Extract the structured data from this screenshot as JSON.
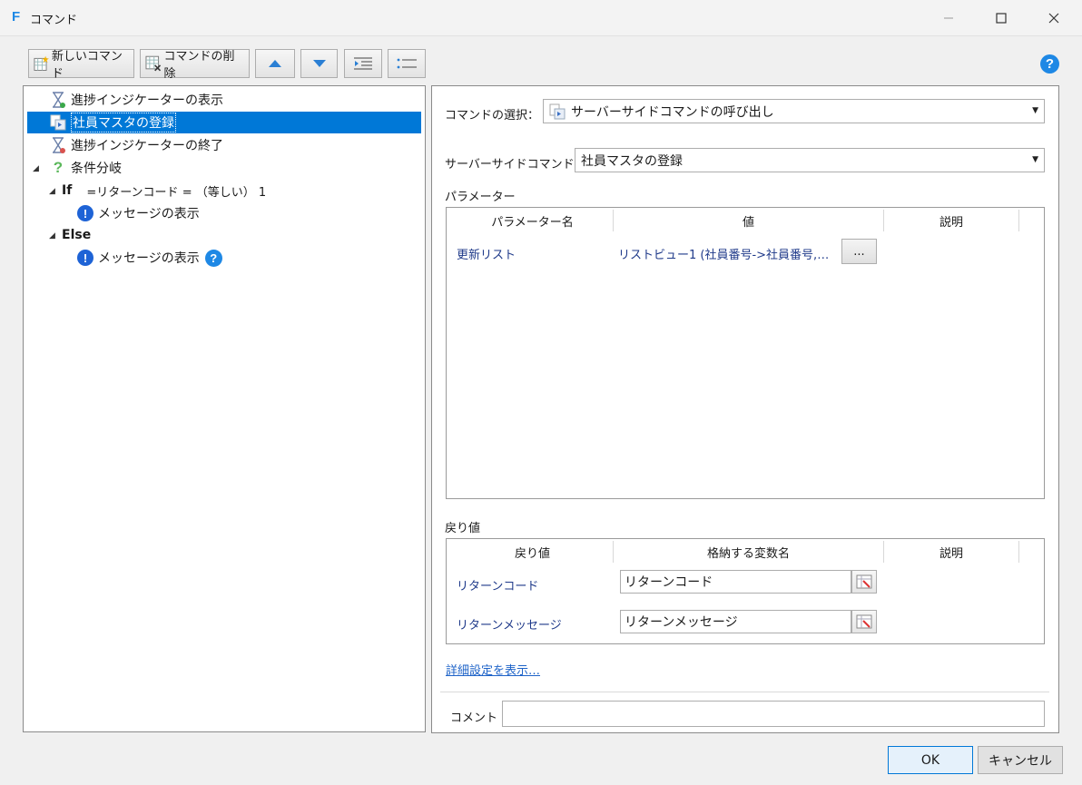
{
  "window": {
    "title": "コマンド"
  },
  "toolbar": {
    "new_command": "新しいコマンド",
    "delete_command": "コマンドの削除"
  },
  "tree": {
    "items": [
      {
        "label": "進捗インジケーターの表示",
        "icon": "hourglass-icon"
      },
      {
        "label": "社員マスタの登録",
        "icon": "server-command-icon"
      },
      {
        "label": "進捗インジケーターの終了",
        "icon": "hourglass-icon"
      },
      {
        "label": "条件分岐",
        "icon": "question-icon"
      },
      {
        "label": "If",
        "condition": "=リターンコード = （等しい） 1"
      },
      {
        "label": "メッセージの表示",
        "icon": "info-icon"
      },
      {
        "label": "Else"
      },
      {
        "label": "メッセージの表示",
        "icon": "info-icon"
      }
    ]
  },
  "form": {
    "command_select_label": "コマンドの選択：",
    "command_select_value": "サーバーサイドコマンドの呼び出し",
    "server_command_label": "サーバーサイドコマンド：",
    "server_command_value": "社員マスタの登録",
    "params_label": "パラメーター",
    "params_columns": [
      "パラメーター名",
      "値",
      "説明"
    ],
    "params_rows": [
      {
        "name": "更新リスト",
        "value": "リストビュー1 (社員番号->社員番号,…",
        "button": "..."
      }
    ],
    "returns_label": "戻り値",
    "returns_columns": [
      "戻り値",
      "格納する変数名",
      "説明"
    ],
    "returns_rows": [
      {
        "name": "リターンコード",
        "variable": "リターンコード"
      },
      {
        "name": "リターンメッセージ",
        "variable": "リターンメッセージ"
      }
    ],
    "details_link": "詳細設定を表示…",
    "comment_label": "コメント"
  },
  "buttons": {
    "ok": "OK",
    "cancel": "キャンセル"
  },
  "colors": {
    "accent": "#0078d7",
    "help": "#1e88e5",
    "info": "#1e63d6",
    "link": "#1e63c8"
  }
}
